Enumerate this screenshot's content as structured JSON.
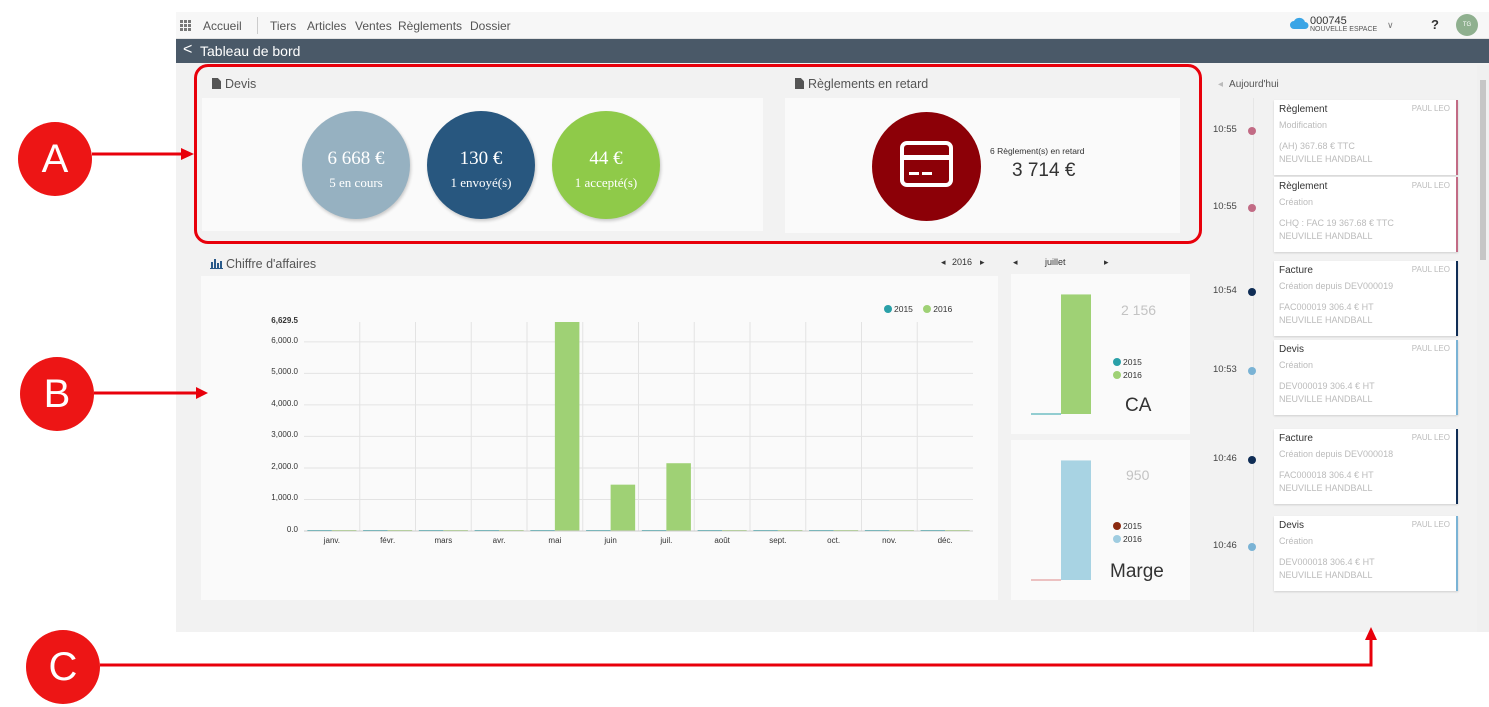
{
  "topbar": {
    "home": "Accueil",
    "menu": [
      "Tiers",
      "Articles",
      "Ventes",
      "Règlements",
      "Dossier"
    ],
    "account_id": "000745",
    "account_name": "NOUVELLE ESPACE",
    "help": "?",
    "avatar_initials": "TG"
  },
  "titlebar": {
    "back": "<",
    "title": "Tableau de bord"
  },
  "devis": {
    "title": "Devis",
    "circles": [
      {
        "amount": "6 668 €",
        "label": "5 en cours",
        "color": "#96b1c1"
      },
      {
        "amount": "130 €",
        "label": "1 envoyé(s)",
        "color": "#28577f"
      },
      {
        "amount": "44 €",
        "label": "1 accepté(s)",
        "color": "#8fca49"
      }
    ]
  },
  "late": {
    "title": "Règlements en retard",
    "count_label": "6 Règlement(s) en retard",
    "amount": "3 714 €",
    "color": "#8c0007",
    "icon": "credit-card-icon"
  },
  "ca": {
    "title": "Chiffre d'affaires",
    "year_pager": "2016",
    "month_pager": "juillet",
    "mini_ca": {
      "value": "2 156",
      "label": "CA",
      "legend": [
        "2015",
        "2016"
      ],
      "bar_fraction": 0.98
    },
    "mini_marge": {
      "value": "950",
      "label": "Marge",
      "legend": [
        "2015",
        "2016"
      ],
      "bar_fraction": 0.98
    }
  },
  "chart_data": {
    "type": "bar",
    "title": "",
    "categories": [
      "janv.",
      "févr.",
      "mars",
      "avr.",
      "mai",
      "juin",
      "juil.",
      "août",
      "sept.",
      "oct.",
      "nov.",
      "déc."
    ],
    "series": [
      {
        "name": "2015",
        "color": "#2aa0a8",
        "values": [
          0,
          0,
          0,
          0,
          0,
          0,
          0,
          0,
          0,
          0,
          0,
          0
        ]
      },
      {
        "name": "2016",
        "color": "#9fd175",
        "values": [
          0,
          0,
          0,
          0,
          6629.5,
          1470,
          2150,
          0,
          0,
          0,
          0,
          0
        ]
      }
    ],
    "ylim": [
      0,
      6629.5
    ],
    "yticks": [
      "6,629.5",
      "6,000.0",
      "5,000.0",
      "4,000.0",
      "3,000.0",
      "2,000.0",
      "1,000.0",
      "0.0"
    ],
    "legend_position": "top-right",
    "grid": true
  },
  "timeline": {
    "header": "Aujourd'hui",
    "events": [
      {
        "time": "10:55",
        "type": "Règlement",
        "user": "PAUL LEO",
        "action": "Modification",
        "detail": "(AH) 367.68 € TTC",
        "org": "NEUVILLE HANDBALL",
        "color": "#c26b85"
      },
      {
        "time": "10:55",
        "type": "Règlement",
        "user": "PAUL LEO",
        "action": "Création",
        "detail": "CHQ : FAC 19 367.68 € TTC",
        "org": "NEUVILLE HANDBALL",
        "color": "#c26b85"
      },
      {
        "time": "10:54",
        "type": "Facture",
        "user": "PAUL LEO",
        "action": "Création depuis DEV000019",
        "detail": "FAC000019 306.4 € HT",
        "org": "NEUVILLE HANDBALL",
        "color": "#0f2d55"
      },
      {
        "time": "10:53",
        "type": "Devis",
        "user": "PAUL LEO",
        "action": "Création",
        "detail": "DEV000019 306.4 € HT",
        "org": "NEUVILLE HANDBALL",
        "color": "#7ab3d5"
      },
      {
        "time": "10:46",
        "type": "Facture",
        "user": "PAUL LEO",
        "action": "Création depuis DEV000018",
        "detail": "FAC000018 306.4 € HT",
        "org": "NEUVILLE HANDBALL",
        "color": "#0f2d55"
      },
      {
        "time": "10:46",
        "type": "Devis",
        "user": "PAUL LEO",
        "action": "Création",
        "detail": "DEV000018 306.4 € HT",
        "org": "NEUVILLE HANDBALL",
        "color": "#7ab3d5"
      }
    ]
  },
  "annotations": {
    "a": "A",
    "b": "B",
    "c": "C",
    "color": "#ed1515"
  }
}
